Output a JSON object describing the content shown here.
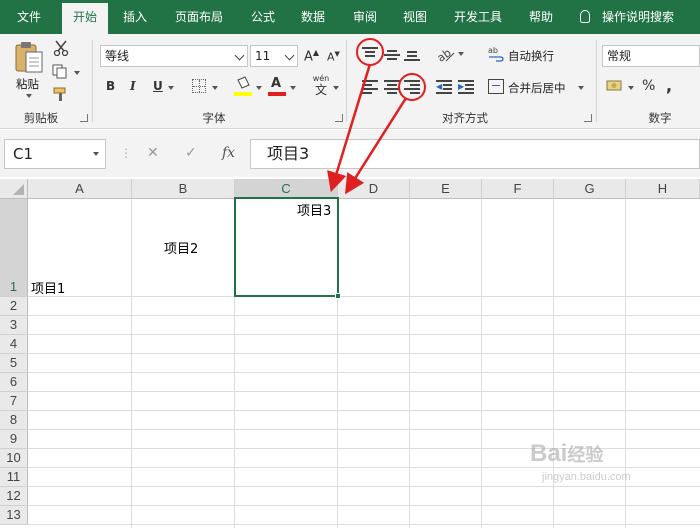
{
  "tabs": [
    "文件",
    "开始",
    "插入",
    "页面布局",
    "公式",
    "数据",
    "审阅",
    "视图",
    "开发工具",
    "帮助"
  ],
  "active_tab": "开始",
  "tell_me": "操作说明搜索",
  "clipboard": {
    "paste_label": "粘贴",
    "group_label": "剪贴板"
  },
  "font": {
    "name": "等线",
    "size": "11",
    "group_label": "字体",
    "bold": "B",
    "italic": "I",
    "underline": "U",
    "grow": "A",
    "shrink": "A",
    "phonetic_top": "wén",
    "phonetic_bottom": "文"
  },
  "alignment": {
    "wrap_text": "自动换行",
    "merge_center": "合并后居中",
    "group_label": "对齐方式"
  },
  "number": {
    "format": "常规",
    "group_label": "数字",
    "percent": "%",
    "comma": ","
  },
  "formula_bar": {
    "name_box": "C1",
    "cancel": "✕",
    "enter": "✓",
    "fx": "fx",
    "content": "项目3"
  },
  "columns": [
    "A",
    "B",
    "C",
    "D",
    "E",
    "F",
    "G",
    "H"
  ],
  "selected_column": "C",
  "rows": [
    "1",
    "2",
    "3",
    "4",
    "5",
    "6",
    "7",
    "8",
    "9",
    "10",
    "11",
    "12",
    "13"
  ],
  "selected_row": "1",
  "cells": {
    "A1": "项目1",
    "B1": "项目2",
    "C1": "项目3"
  },
  "watermark": {
    "logo": "Bai",
    "logo_suffix": "经验",
    "url": "jingyan.baidu.com"
  },
  "colors": {
    "brand": "#217346",
    "annotation": "#e02020",
    "font_color": "#e02020",
    "fill_color": "#ffff00"
  }
}
